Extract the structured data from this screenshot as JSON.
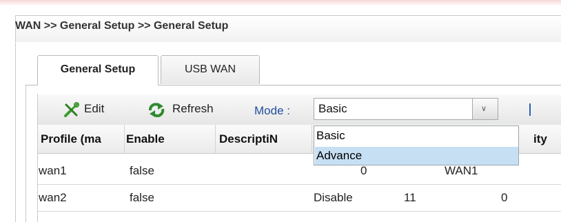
{
  "breadcrumb": "WAN >> General Setup >> General Setup",
  "tabs": [
    {
      "label": "General Setup",
      "active": true
    },
    {
      "label": "USB WAN",
      "active": false
    }
  ],
  "toolbar": {
    "edit_label": "Edit",
    "refresh_label": "Refresh",
    "mode_label": "Mode :",
    "mode_value": "Basic",
    "mode_options": [
      "Basic",
      "Advance"
    ],
    "highlighted_option": "Advance"
  },
  "table": {
    "headers": [
      "Profile (ma",
      "Enable",
      "DescriptiN",
      "ity"
    ],
    "rows": [
      {
        "profile": "wan1",
        "enable": "false",
        "c4": "0",
        "c5": "",
        "c6": "WAN1"
      },
      {
        "profile": "wan2",
        "enable": "false",
        "c4": "Disable",
        "c5": "11",
        "c6": "0"
      }
    ]
  },
  "colors": {
    "accent": "#1f4e9c",
    "highlight": "#c7dff3",
    "edit_icon": "#3a9b2c",
    "refresh_icon": "#2f8a2f"
  }
}
